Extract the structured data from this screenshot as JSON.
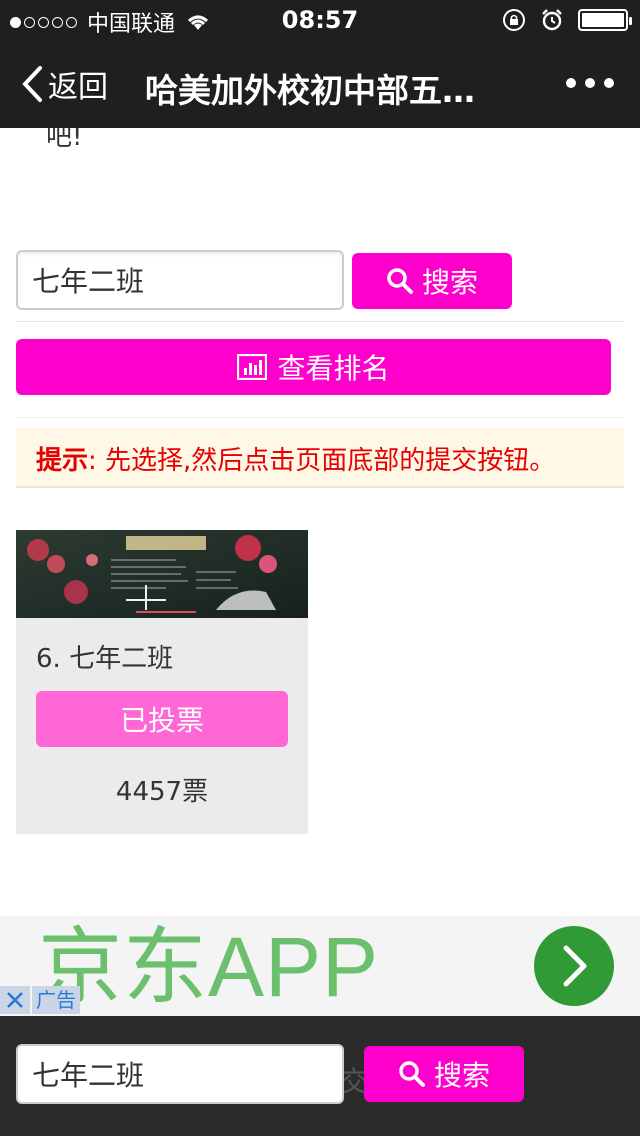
{
  "status_bar": {
    "carrier": "中国联通",
    "time": "08:57",
    "signal_filled": 1,
    "signal_total": 5
  },
  "nav": {
    "back_label": "返回",
    "title": "哈美加外校初中部五…"
  },
  "content": {
    "clipped_text": "吧!",
    "search": {
      "value": "七年二班",
      "button_label": "搜索"
    },
    "rank_button_label": "查看排名",
    "tip": {
      "label": "提示",
      "separator": ":",
      "text": "先选择,然后点击页面底部的提交按钮。"
    },
    "entry": {
      "title": "6. 七年二班",
      "vote_button_label": "已投票",
      "votes": "4457票"
    }
  },
  "ad": {
    "headline": "京东APP",
    "close_symbol": "✕",
    "label": "广告"
  },
  "bottom_bar": {
    "search_value": "七年二班",
    "ghost_text": "交",
    "button_label": "搜索"
  },
  "colors": {
    "accent": "#ff00cc",
    "voted": "#ff66d6",
    "tip_text": "#e60000",
    "ad_green": "#2f9a36"
  }
}
